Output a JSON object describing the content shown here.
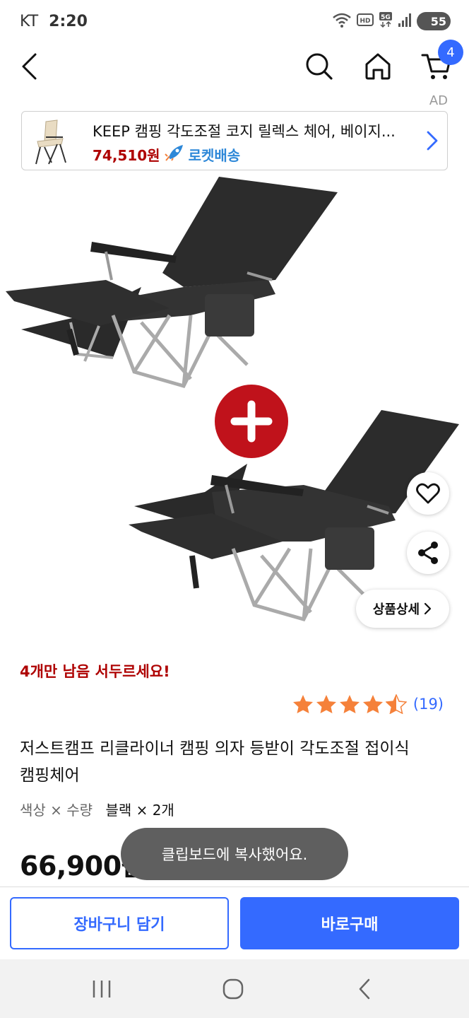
{
  "status_bar": {
    "carrier": "KT",
    "time": "2:20",
    "battery": "55"
  },
  "header": {
    "cart_count": "4"
  },
  "ad": {
    "label": "AD",
    "title": "KEEP 캠핑 각도조절 코지 릴렉스 체어, 베이지...",
    "price": "74,510원",
    "shipping": "로켓배송"
  },
  "product": {
    "stock_warning": "4개만 남음 서두르세요!",
    "rating": 4.5,
    "review_count": "(19)",
    "title": "저스트캠프 리클라이너 캠핑 의자 등받이 각도조절 접이식 캠핑체어",
    "option_label": "색상 × 수량",
    "option_value": "블랙 × 2개",
    "price": "66,900원",
    "detail_button": "상품상세"
  },
  "toast": {
    "message": "클립보드에 복사했어요."
  },
  "actions": {
    "add_to_cart": "장바구니 담기",
    "buy_now": "바로구매"
  },
  "colors": {
    "accent_blue": "#346aff",
    "warning_red": "#ae0000",
    "star_orange": "#f5813a",
    "rocket_blue": "#2e88d8"
  },
  "icons": [
    "back-arrow-icon",
    "search-icon",
    "home-icon",
    "cart-icon",
    "rocket-icon",
    "chevron-right-icon",
    "heart-icon",
    "share-icon",
    "star-icon",
    "recents-icon",
    "nav-home-icon",
    "nav-back-icon"
  ]
}
